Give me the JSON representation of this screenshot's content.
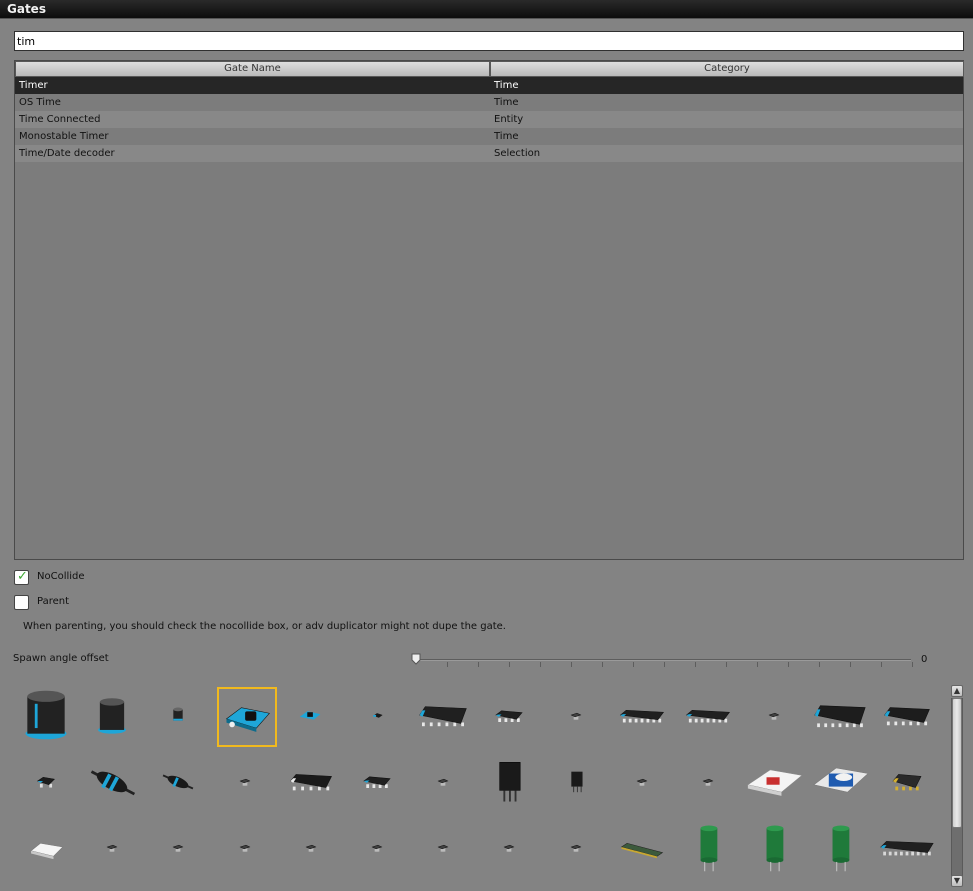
{
  "window": {
    "title": "Gates"
  },
  "search": {
    "value": "tim"
  },
  "table": {
    "columns": [
      "Gate Name",
      "Category"
    ],
    "rows": [
      {
        "name": "Timer",
        "category": "Time"
      },
      {
        "name": "OS Time",
        "category": "Time"
      },
      {
        "name": "Time Connected",
        "category": "Entity"
      },
      {
        "name": "Monostable Timer",
        "category": "Time"
      },
      {
        "name": "Time/Date decoder",
        "category": "Selection"
      }
    ]
  },
  "options": {
    "nocollide_label": "NoCollide",
    "nocollide_checked": true,
    "parent_label": "Parent",
    "parent_checked": false,
    "hint": "When parenting, you should check the nocollide box, or adv duplicator might not dupe the gate."
  },
  "spawn": {
    "label": "Spawn angle offset",
    "value": "0"
  },
  "models": {
    "rows": [
      [
        "capacitor-large-icon",
        "capacitor-medium-icon",
        "capacitor-small-icon",
        "timer-chip-icon",
        "timer-chip-small-icon",
        "micro-chip-icon",
        "wire-chip-8pin-icon",
        "chip-small-icon",
        "chip-tiny-icon",
        "chip-long-icon",
        "chip-long-icon",
        "chip-tiny-icon",
        "wire-chip-large-icon",
        "wire-chip-medium-icon"
      ],
      [
        "chip-square-icon",
        "resistor-large-icon",
        "resistor-medium-icon",
        "chip-tiny-icon",
        "chip-6pin-icon",
        "chip-small-icon",
        "chip-tiny-icon",
        "transistor-large-icon",
        "transistor-small-icon",
        "chip-tiny-icon",
        "chip-tiny-icon",
        "cpu-white-icon",
        "cpu-blue-icon",
        "chip-gold-icon"
      ],
      [
        "chip-white-icon",
        "chip-tiny-icon",
        "chip-tiny-icon",
        "chip-tiny-icon",
        "chip-tiny-icon",
        "chip-tiny-icon",
        "chip-tiny-icon",
        "chip-tiny-icon",
        "chip-tiny-icon",
        "ram-stick-icon",
        "capacitor-green-icon",
        "capacitor-green-icon",
        "capacitor-green-icon",
        "chip-long-dark-icon"
      ]
    ],
    "selected": "timer-chip-icon"
  }
}
